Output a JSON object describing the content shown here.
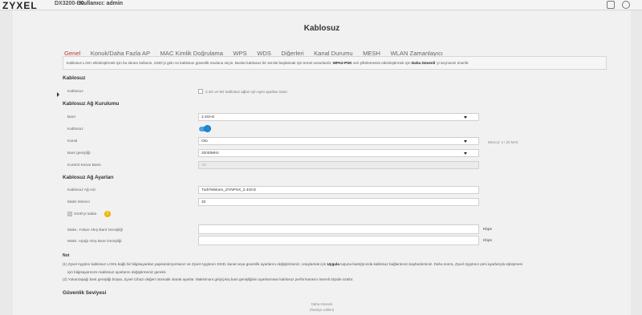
{
  "header": {
    "logo": "ZYXEL",
    "model": "DX3200-B0",
    "user_label": "Kullanıcı: admin"
  },
  "page_title": "Kablosuz",
  "tabs": [
    {
      "label": "Genel",
      "active": true
    },
    {
      "label": "Konuk/Daha Fazla AP",
      "active": false
    },
    {
      "label": "MAC Kimlik Doğrulama",
      "active": false
    },
    {
      "label": "WPS",
      "active": false
    },
    {
      "label": "WDS",
      "active": false
    },
    {
      "label": "Diğerleri",
      "active": false
    },
    {
      "label": "Kanal Durumu",
      "active": false
    },
    {
      "label": "MESH",
      "active": false
    },
    {
      "label": "WLAN Zamanlayıcı",
      "active": false
    }
  ],
  "info": {
    "part1": "Kablosuz LAN'ı etkinleştirmek için bu ekranı kullanın, SSID'yi girin ve kablosuz güvenlik modunu seçin. Bunlar kablosuz bir servisi başlatmak için temel unsurlardır.",
    "bold1": "WPA2-PSK",
    "part2": "veri şifrelemesini etkinleştirmek için",
    "bold2": "Daha Güvenli",
    "part3": "'yi seçmeniz önerilir."
  },
  "sections": {
    "kablosuz": {
      "title": "Kablosuz",
      "label": "Kablosuz",
      "checkbox_text": "2.4G ve 5G kablosuz ağları için aynı ayarları tutun"
    },
    "network": {
      "title": "Kablosuz Ağ Kurulumu",
      "band_label": "Bant",
      "band_value": "2.4GHz",
      "wireless_label": "Kablosuz",
      "wireless_on": true,
      "channel_label": "Kanal",
      "channel_value": "Oto",
      "channel_hint": "Mevcut: 2 / 20 MHz",
      "bandwidth_label": "Bant genişliği",
      "bandwidth_value": "20/40MHz",
      "control_label": "Kontrol Kenar Bantı",
      "control_value": "Alt"
    },
    "settings": {
      "title": "Kablosuz Ağ Ayarları",
      "ssid_label": "Kablosuz Ağ Adı",
      "ssid_value": "TurkTelekom_ZYNPSX_2.4GHz",
      "maxclients_label": "Maks İstemci",
      "maxclients_value": "32",
      "hide_ssid_label": "SSID'yi sakla",
      "warn_symbol": "!"
    },
    "bandwidth_limits": {
      "up_label": "Maks. Yukarı Akış Bant Genişliği",
      "up_unit": "Kbps",
      "down_label": "Maks. Aşağı Akış Bant Genişliği",
      "down_unit": "Kbps"
    }
  },
  "notes": {
    "title": "Not",
    "n1a": "(1) Zyxel Aygıtını kablosuz LAN'a bağlı bir bilgisayardan yapılandırıyorsanız ve Zyxel Aygıtının SSID, kanal veya güvenlik ayarlarını değiştirirseniz, onaylamak için",
    "n1b": "Uygula",
    "n1c": "tuşuna bastığınızda kablosuz bağlantınızı kaybedersiniz. Daha sonra, Zyxel Aygıtının yeni ayarlarıyla eşleşmesi",
    "n1d": "için bilgisayarınızın kablosuz ayarlarını değiştirmeniz gerekir.",
    "n2": "(2) Yukarı/aşağı bant genişliği boşsa, Zyxel Cihazı değeri otomatik olarak ayarlar. Maksimum giriş/çıkış bant genişliğinin ayarlanması kablosuz performansını önemli ölçüde azaltır."
  },
  "security": {
    "title": "Güvenlik Seviyesi",
    "level": "Daha Güvenli",
    "recommended": "(Tavsiye edilen)"
  }
}
